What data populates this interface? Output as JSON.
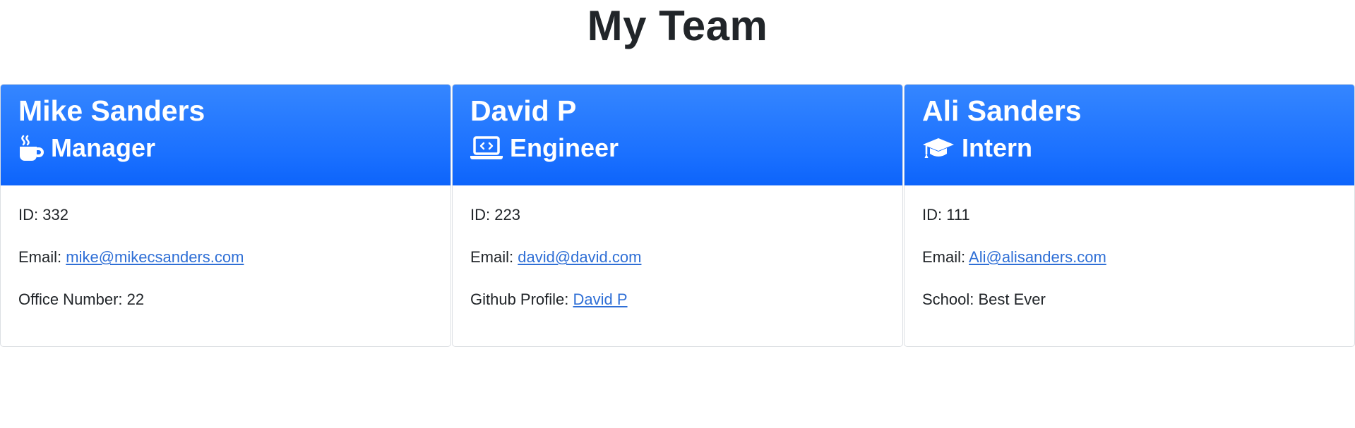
{
  "page": {
    "title": "My Team"
  },
  "colors": {
    "header_blue": "#1a70ff",
    "link_blue": "#2f6fd6"
  },
  "members": [
    {
      "name": "Mike Sanders",
      "role": "Manager",
      "role_icon": "coffee-mug-icon",
      "id_label": "ID: 332",
      "email_prefix": "Email: ",
      "email": "mike@mikecsanders.com",
      "extra_prefix": "Office Number: 22",
      "extra_link": ""
    },
    {
      "name": "David P",
      "role": "Engineer",
      "role_icon": "laptop-code-icon",
      "id_label": "ID: 223",
      "email_prefix": "Email: ",
      "email": "david@david.com",
      "extra_prefix": "Github Profile: ",
      "extra_link": "David P"
    },
    {
      "name": "Ali Sanders",
      "role": "Intern",
      "role_icon": "graduation-cap-icon",
      "id_label": "ID: 111",
      "email_prefix": "Email: ",
      "email": "Ali@alisanders.com",
      "extra_prefix": "School: Best Ever",
      "extra_link": ""
    }
  ]
}
